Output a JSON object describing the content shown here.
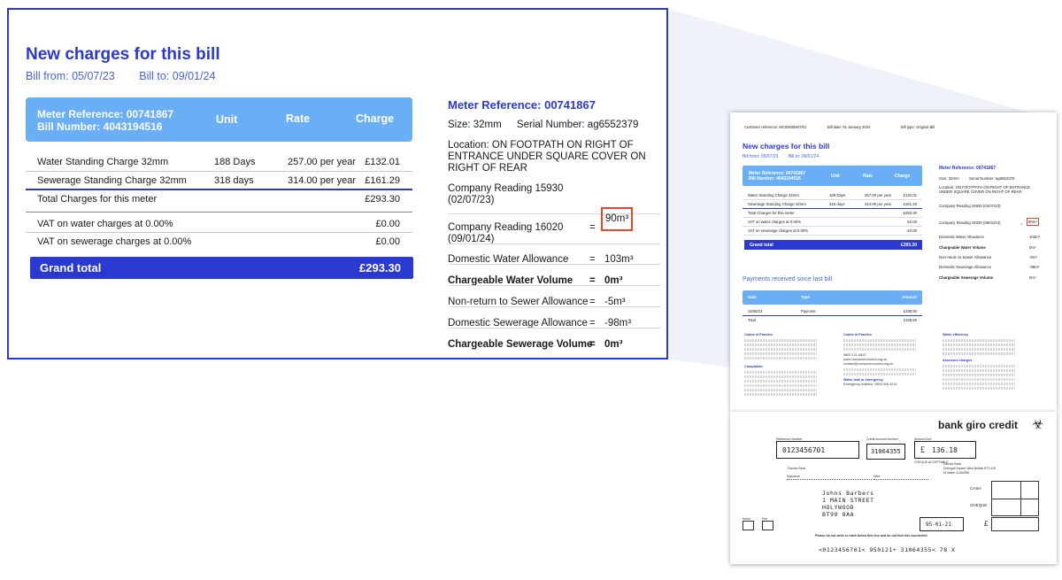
{
  "zoom": {
    "title": "New charges for this bill",
    "bill_from": "Bill from: 05/07/23",
    "bill_to": "Bill to: 09/01/24",
    "table_header": {
      "meter_ref": "Meter Reference: 00741867",
      "bill_number": "Bill Number: 4043194516",
      "unit": "Unit",
      "rate": "Rate",
      "charge": "Charge"
    },
    "rows": [
      {
        "label": "Water Standing Charge 32mm",
        "unit": "188 Days",
        "rate": "257.00 per year",
        "value": "£132.01"
      },
      {
        "label": "Sewerage Standing Charge 32mm",
        "unit": "318 days",
        "rate": "314.00 per year",
        "value": "£161.29"
      },
      {
        "label": "Total Charges for this meter",
        "unit": "",
        "rate": "",
        "value": "£293.30"
      },
      {
        "label": "VAT on water charges at 0.00%",
        "unit": "",
        "rate": "",
        "value": "£0.00"
      },
      {
        "label": "VAT on sewerage charges at 0.00%",
        "unit": "",
        "rate": "",
        "value": "£0.00"
      }
    ],
    "grand_total_label": "Grand total",
    "grand_total_value": "£293.30",
    "meter": {
      "ref": "Meter Reference: 00741867",
      "size": "Size: 32mm",
      "serial": "Serial Number: ag6552379",
      "location_1": "Location: ON FOOTPATH ON RIGHT OF",
      "location_2": "ENTRANCE UNDER SQUARE COVER ON",
      "location_3": "RIGHT OF REAR",
      "reading1_a": "Company Reading 15930",
      "reading1_b": "(02/07/23)",
      "reading2_a": "Company Reading 16020",
      "reading2_b": "(09/01/24)",
      "reading2_value": "90m³",
      "items": [
        {
          "label": "Domestic Water Allowance",
          "value": "103m³",
          "bold": false
        },
        {
          "label": "Chargeable Water Volume",
          "value": "0m³",
          "bold": true
        },
        {
          "label": "Non-return to Sewer Allowance",
          "value": "-5m³",
          "bold": false
        },
        {
          "label": "Domestic Sewerage Allowance",
          "value": "-98m³",
          "bold": false
        },
        {
          "label": "Chargeable Sewerage Volume",
          "value": "0m³",
          "bold": true
        }
      ],
      "eq": "="
    },
    "accent_color": "#2a3ad1",
    "header_color": "#6aaef6",
    "highlight_color": "#e4472b"
  },
  "bill": {
    "customer_ref": "Customer reference: MC00645847/01",
    "bill_date": "Bill date: 01 January 2024",
    "bill_type": "Bill type: Original Bill",
    "title": "New charges for this bill",
    "bill_from": "Bill from: 05/07/23",
    "bill_to": "Bill to: 09/01/24",
    "hdr_ref": "Meter Reference: 00741867",
    "hdr_bill": "Bill Number: 4043194516",
    "hdr_unit": "Unit",
    "hdr_rate": "Rate",
    "hdr_charge": "Charge",
    "rows": [
      {
        "l": "Water Standing Charge 32mm",
        "u": "188 Days",
        "r": "257.00 per year",
        "v": "£132.01"
      },
      {
        "l": "Sewerage Standing Charge 32mm",
        "u": "318 days",
        "r": "314.00 per year",
        "v": "£161.29"
      },
      {
        "l": "Total Charges for this meter",
        "u": "",
        "r": "",
        "v": "£293.30"
      },
      {
        "l": "VAT on water charges at 0.00%",
        "u": "",
        "r": "",
        "v": "£0.00"
      },
      {
        "l": "VAT on sewerage charges at 0.00%",
        "u": "",
        "r": "",
        "v": "£0.00"
      }
    ],
    "grand_label": "Grand total",
    "grand_value": "£293.30",
    "meter_ref": "Meter Reference: 00741867",
    "meter_size": "Size: 32mm",
    "meter_serial": "Serial Number: ag6552379",
    "meter_loc": "Location: ON FOOTPATH ON RIGHT OF ENTRANCE UNDER SQUARE COVER ON RIGHT OF REAR",
    "meter_r1": "Company Reading 15930 (02/07/23)",
    "meter_r2": "Company Reading 16020 (09/01/24)",
    "meter_r2_val": "90m³",
    "meter_items": [
      {
        "l": "Domestic Water Allowance",
        "v": "103m³"
      },
      {
        "l": "Chargeable Water Volume",
        "v": "0m³"
      },
      {
        "l": "Non-return to Sewer Allowance",
        "v": "-5m³"
      },
      {
        "l": "Domestic Sewerage Allowance",
        "v": "-98m³"
      },
      {
        "l": "Chargeable Sewerage Volume",
        "v": "0m³"
      }
    ],
    "payments_title": "Payments received since last bill",
    "pay_hdr_date": "Date",
    "pay_hdr_type": "Type",
    "pay_hdr_amount": "Amount",
    "pay_row": {
      "date": "16/08/23",
      "type": "Payment",
      "amount": "£338.50"
    },
    "pay_total_label": "Total",
    "pay_total_value": "£338.50",
    "col1_h1": "Codes of Practice",
    "col1_h2": "Complaints",
    "col2_h1": "Codes of Practice",
    "col2_phone": "0800 121 6022",
    "col2_web": "www.consumercouncil.org.uk",
    "col2_email": "contact@consumercouncil.org.uk",
    "col2_h2": "Water leak or emergency",
    "col2_leak": "Emergency leakline: 0800 028 2011",
    "col3_h1": "Water efficiency",
    "col3_h2": "Assessed charges"
  },
  "giro": {
    "title": "bank giro credit",
    "ref_number": "0123456701",
    "credit_account": "31064355",
    "amount_symbol": "£",
    "amount": "136.18",
    "addr_1": "Johns Barbers",
    "addr_2": "1 MAIN STREET",
    "addr_3": "HOLYWOOD",
    "addr_4": "BT99 8AA",
    "date_box": "95-01-21",
    "cash": "CASH",
    "cheque": "CHEQUE",
    "pound": "£",
    "micr": "<0123456701< 950121+ 31064355< 78 X",
    "lbl_ref": "Reference Number",
    "lbl_credit": "Credit account Number",
    "lbl_amount": "Amount Due",
    "lbl_cheque_acc": "CHEQUE ACCEPTABLE",
    "lbl_signature": "Signature",
    "lbl_date": "Date",
    "lbl_notes": "Notes",
    "lbl_fee": "Fee",
    "lbl_counterfoil": "Please do not write or mark below this line and do not fold this counterfoil",
    "bank_name": "Danske Bank",
    "bank_addr": "Donegall Square West Belfast BT1 6JS",
    "bank_ni": "NI Water 31064355"
  }
}
